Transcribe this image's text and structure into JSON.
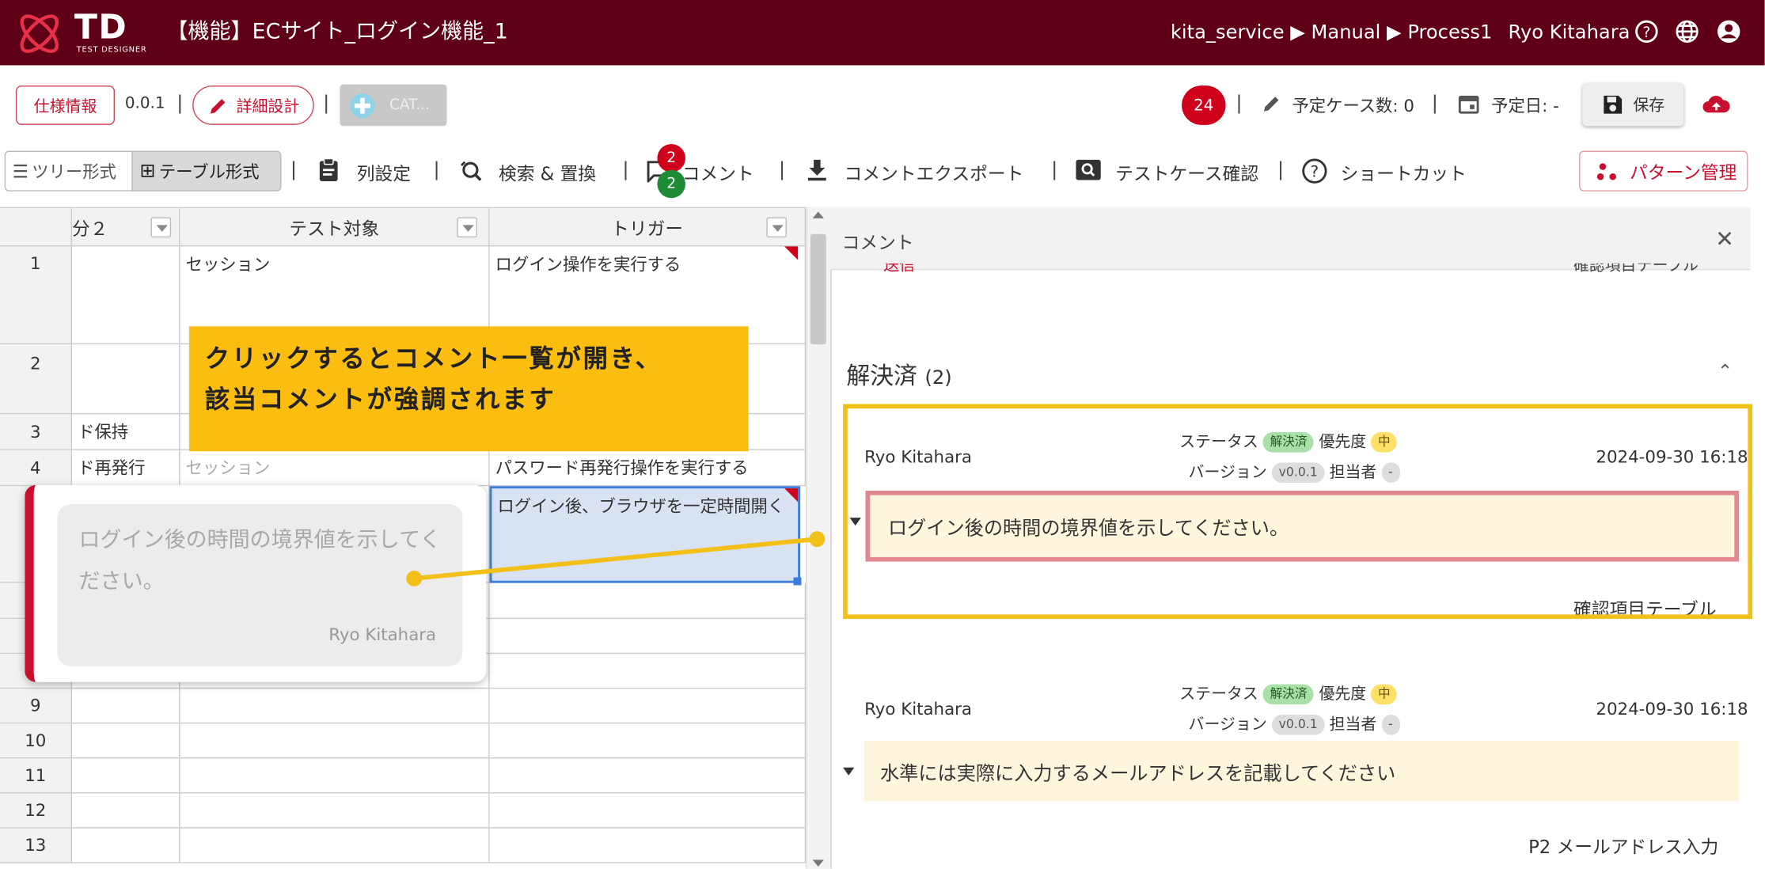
{
  "header": {
    "logo_text": "TD",
    "logo_sub": "TEST DESIGNER",
    "title": "【機能】ECサイト_ログイン機能_1",
    "breadcrumb": "kita_service ▶ Manual ▶ Process1",
    "user": "Ryo Kitahara",
    "icons": [
      "help-icon",
      "globe-icon",
      "account-icon"
    ]
  },
  "toolbar": {
    "spec_label": "仕様情報",
    "version": "0.0.1",
    "design_label": "詳細設計",
    "cat_label": "CAT...",
    "count_badge": "24",
    "planned_cases": "予定ケース数: 0",
    "planned_date": "予定日: -",
    "save_label": "保存",
    "sep": "|"
  },
  "toolbar2": {
    "tree_label": "ツリー形式",
    "table_label": "テーブル形式",
    "columns_label": "列設定",
    "search_label": "検索 & 置換",
    "comment_label": "コメント",
    "comment_badge_red": "2",
    "comment_badge_green": "2",
    "export_label": "コメントエクスポート",
    "testcase_label": "テストケース確認",
    "shortcut_label": "ショートカット",
    "pattern_label": "パターン管理"
  },
  "grid": {
    "headers": [
      "分２",
      "テスト対象",
      "トリガー"
    ],
    "rows": [
      {
        "num": "1",
        "c1": "",
        "c2": "セッション",
        "c3": "ログイン操作を実行する"
      },
      {
        "num": "2",
        "c1": "",
        "c2": "",
        "c3": ""
      },
      {
        "num": "3",
        "c1": "ド保持",
        "c2": "",
        "c3": ""
      },
      {
        "num": "4",
        "c1": "ド再発行",
        "c2": "セッション",
        "c3": "パスワード再発行操作を実行する"
      },
      {
        "num": "",
        "c1": "",
        "c2": "",
        "c3": "ログイン後、ブラウザを一定時間開く"
      },
      {
        "num": "9",
        "c1": "",
        "c2": "",
        "c3": ""
      },
      {
        "num": "10",
        "c1": "",
        "c2": "",
        "c3": ""
      },
      {
        "num": "11",
        "c1": "",
        "c2": "",
        "c3": ""
      },
      {
        "num": "12",
        "c1": "",
        "c2": "",
        "c3": ""
      },
      {
        "num": "13",
        "c1": "",
        "c2": "",
        "c3": ""
      }
    ]
  },
  "callout": {
    "line1": "クリックするとコメント一覧が開き、",
    "line2": "該当コメントが強調されます"
  },
  "tooltip": {
    "text": "ログイン後の時間の境界値を示してください。",
    "author": "Ryo Kitahara"
  },
  "panel": {
    "title": "コメント",
    "close": "✕",
    "top_partial_left": "送信",
    "top_partial_right": "確認項目テーブル",
    "section_title": "解決済",
    "section_count": "(2)",
    "labels": {
      "status": "ステータス",
      "priority": "優先度",
      "version": "バージョン",
      "assignee": "担当者"
    },
    "comments": [
      {
        "author": "Ryo Kitahara",
        "status": "解決済",
        "priority": "中",
        "version": "v0.0.1",
        "assignee": "-",
        "date": "2024-09-30 16:18",
        "text": "ログイン後の時間の境界値を示してください。",
        "target": "確認項目テーブル"
      },
      {
        "author": "Ryo Kitahara",
        "status": "解決済",
        "priority": "中",
        "version": "v0.0.1",
        "assignee": "-",
        "date": "2024-09-30 16:18",
        "text": "水準には実際に入力するメールアドレスを記載してください",
        "target": "P2 メールアドレス入力"
      }
    ]
  },
  "colors": {
    "brand": "#5f0016",
    "accent": "#c8102e",
    "highlight": "#f3bf19",
    "resolved": "#a8e0a8"
  }
}
